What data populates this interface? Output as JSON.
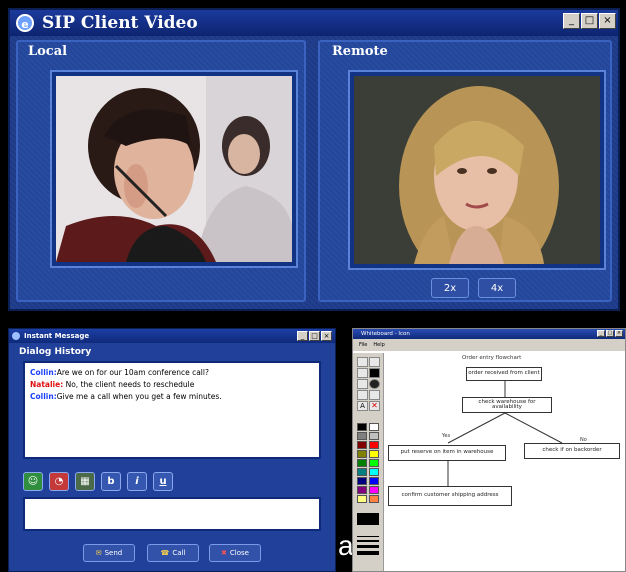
{
  "video_window": {
    "title": "SIP Client Video",
    "controls": [
      "_",
      "□",
      "×"
    ],
    "local_label": "Local",
    "remote_label": "Remote",
    "zoom_buttons": [
      "2x",
      "4x"
    ]
  },
  "im_window": {
    "title": "Instant Message",
    "controls": [
      "_",
      "□",
      "×"
    ],
    "section_label": "Dialog History",
    "messages": [
      {
        "speaker": "Collin:",
        "text": "Are we on for our 10am conference call?",
        "color": "#1a3fff"
      },
      {
        "speaker": "Natalie:",
        "text": "No, the client needs to reschedule",
        "color": "#e01010"
      },
      {
        "speaker": "Collin:",
        "text": "Give me a call when you get a few minutes.",
        "color": "#1a3fff"
      }
    ],
    "format_buttons": [
      "b",
      "i",
      "u"
    ],
    "actions": {
      "send": "Send",
      "call": "Call",
      "close": "Close"
    }
  },
  "whiteboard": {
    "title": "Whiteboard - Icon",
    "menu": [
      "File",
      "Help"
    ],
    "colors": [
      "#000000",
      "#ffffff",
      "#808080",
      "#c0c0c0",
      "#800000",
      "#ff0000",
      "#808000",
      "#ffff00",
      "#008000",
      "#00ff00",
      "#008080",
      "#00ffff",
      "#000080",
      "#0000ff",
      "#800080",
      "#ff00ff",
      "#ffff80",
      "#ff8040"
    ],
    "flowchart": {
      "title": "Order entry flowchart",
      "box1": "order received from client",
      "box2": "check warehouse for availability",
      "yes_label": "Yes",
      "no_label": "No",
      "box_yes": "put reserve on item in warehouse",
      "box_no": "check if on backorder",
      "box4": "confirm customer shipping address"
    }
  },
  "stray_text": "a"
}
